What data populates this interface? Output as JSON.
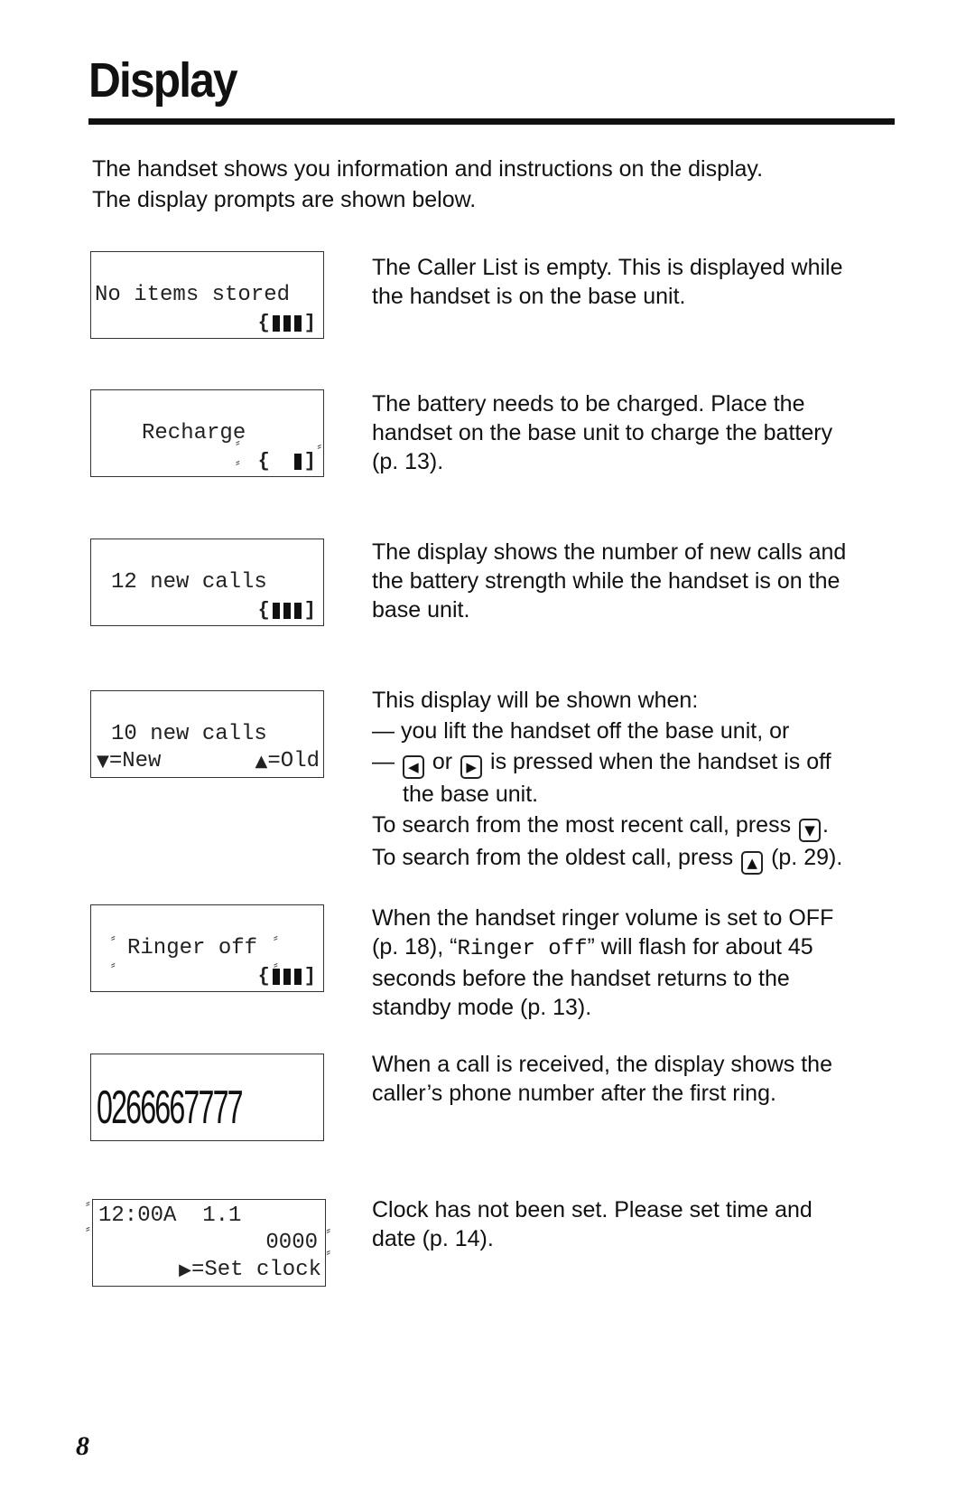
{
  "page": {
    "title": "Display",
    "intro": [
      "The handset shows you information and instructions on the display.",
      "The display prompts are shown below."
    ],
    "page_number": "8"
  },
  "displays": [
    {
      "lines": [
        "No items stored"
      ],
      "battery_level": 1.0,
      "battery_label": "battery full (3 of 3 bars)",
      "description": [
        "The Caller List is empty. This is displayed while",
        "the handset is on the base unit."
      ]
    },
    {
      "lines": [
        "Recharge"
      ],
      "battery_level": 0.33,
      "battery_label": "battery low (1 of 3 bars), flashing",
      "description": [
        "The battery needs to be charged. Place the",
        "handset on the base unit to charge the battery",
        "(p. 13)."
      ]
    },
    {
      "lines": [
        "12 new calls"
      ],
      "battery_level": 1.0,
      "battery_label": "battery full (3 of 3 bars)",
      "description": [
        "The display shows the number of new calls and",
        "the battery strength while the handset is on the",
        "base unit."
      ]
    },
    {
      "lines": [
        "10 new calls",
        "=New",
        "=Old"
      ],
      "icons": {
        "down": "▼",
        "up": "▲"
      },
      "description": {
        "lead": "This display will be shown when:",
        "bullet1": "— you lift the handset off the base unit, or",
        "bullet2_dash": "—",
        "bullet2_or": "or",
        "bullet2_rest": "is pressed when the handset is off",
        "bullet2_cont": "the base unit.",
        "recent_text": "To search from the most recent call, press",
        "recent_end": ".",
        "oldest_text": "To search from the oldest call, press",
        "oldest_end": "(p. 29).",
        "key_left": "◀",
        "key_right": "▶",
        "key_down": "▼",
        "key_up": "▲"
      }
    },
    {
      "lines": [
        "Ringer off"
      ],
      "battery_level": 1.0,
      "battery_label": "battery full (3 of 3 bars)",
      "description": {
        "line1": "When the handset ringer volume is set to OFF",
        "line2_pre": "(p. 18), “",
        "line2_mono": "Ringer off",
        "line2_post": "” will flash for about 45",
        "line3": "seconds before the handset returns to the",
        "line4": "standby mode (p. 13)."
      }
    },
    {
      "lines": [
        "0266667777"
      ],
      "description": [
        "When a call is received, the display shows the",
        "caller’s phone number after the first ring."
      ]
    },
    {
      "lines": [
        "12:00A  1.1",
        "0000",
        "=Set clock"
      ],
      "icons": {
        "right": "▶"
      },
      "description": [
        "Clock has not been set. Please set time and",
        "date (p. 14)."
      ]
    }
  ]
}
